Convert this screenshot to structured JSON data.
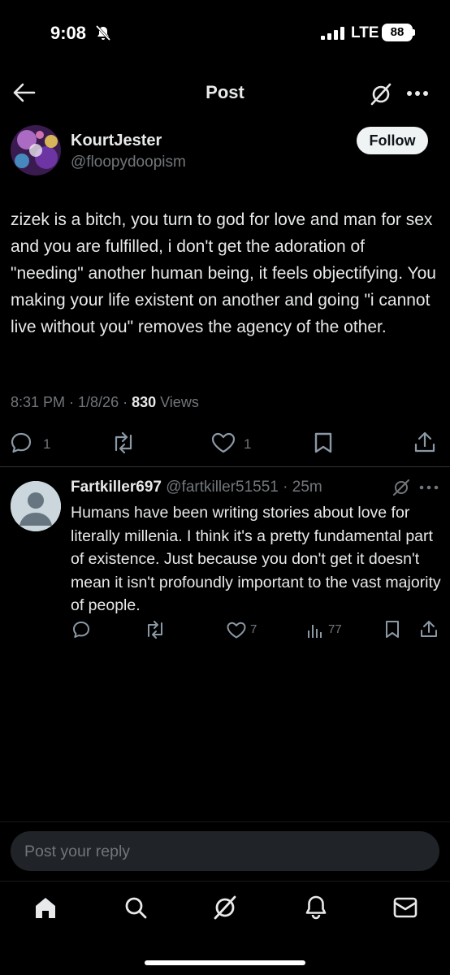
{
  "status_bar": {
    "time": "9:08",
    "network": "LTE",
    "battery": "88"
  },
  "header": {
    "title": "Post"
  },
  "post": {
    "author_name": "KourtJester",
    "author_handle": "@floopydoopism",
    "follow_label": "Follow",
    "text": "zizek is a bitch, you turn to god for love and man for sex and you are fulfilled, i don't get the adoration of \"needing\" another human being, it feels objectifying. You making your life existent on another and going \"i cannot live without you\" removes the agency of the other.",
    "timestamp": "8:31 PM · 1/8/26 · ",
    "views_count": "830",
    "views_label": " Views",
    "reply_count": "1",
    "like_count": "1"
  },
  "reply": {
    "author_name": "Fartkiller697",
    "author_handle": " @fartkiller51551 · 25m",
    "text": "Humans have been writing stories about love for literally millenia. I think it's a pretty fundamental part of existence. Just because you don't get it doesn't mean it isn't profoundly important to the vast majority of people.",
    "like_count": "7",
    "view_count": "77"
  },
  "composer": {
    "placeholder": "Post your reply"
  },
  "icons": [
    "back-arrow-icon",
    "grok-icon",
    "more-icon",
    "reply-icon",
    "repost-icon",
    "like-icon",
    "bookmark-icon",
    "share-icon",
    "views-icon",
    "home-icon",
    "search-icon",
    "notifications-icon",
    "messages-icon"
  ]
}
